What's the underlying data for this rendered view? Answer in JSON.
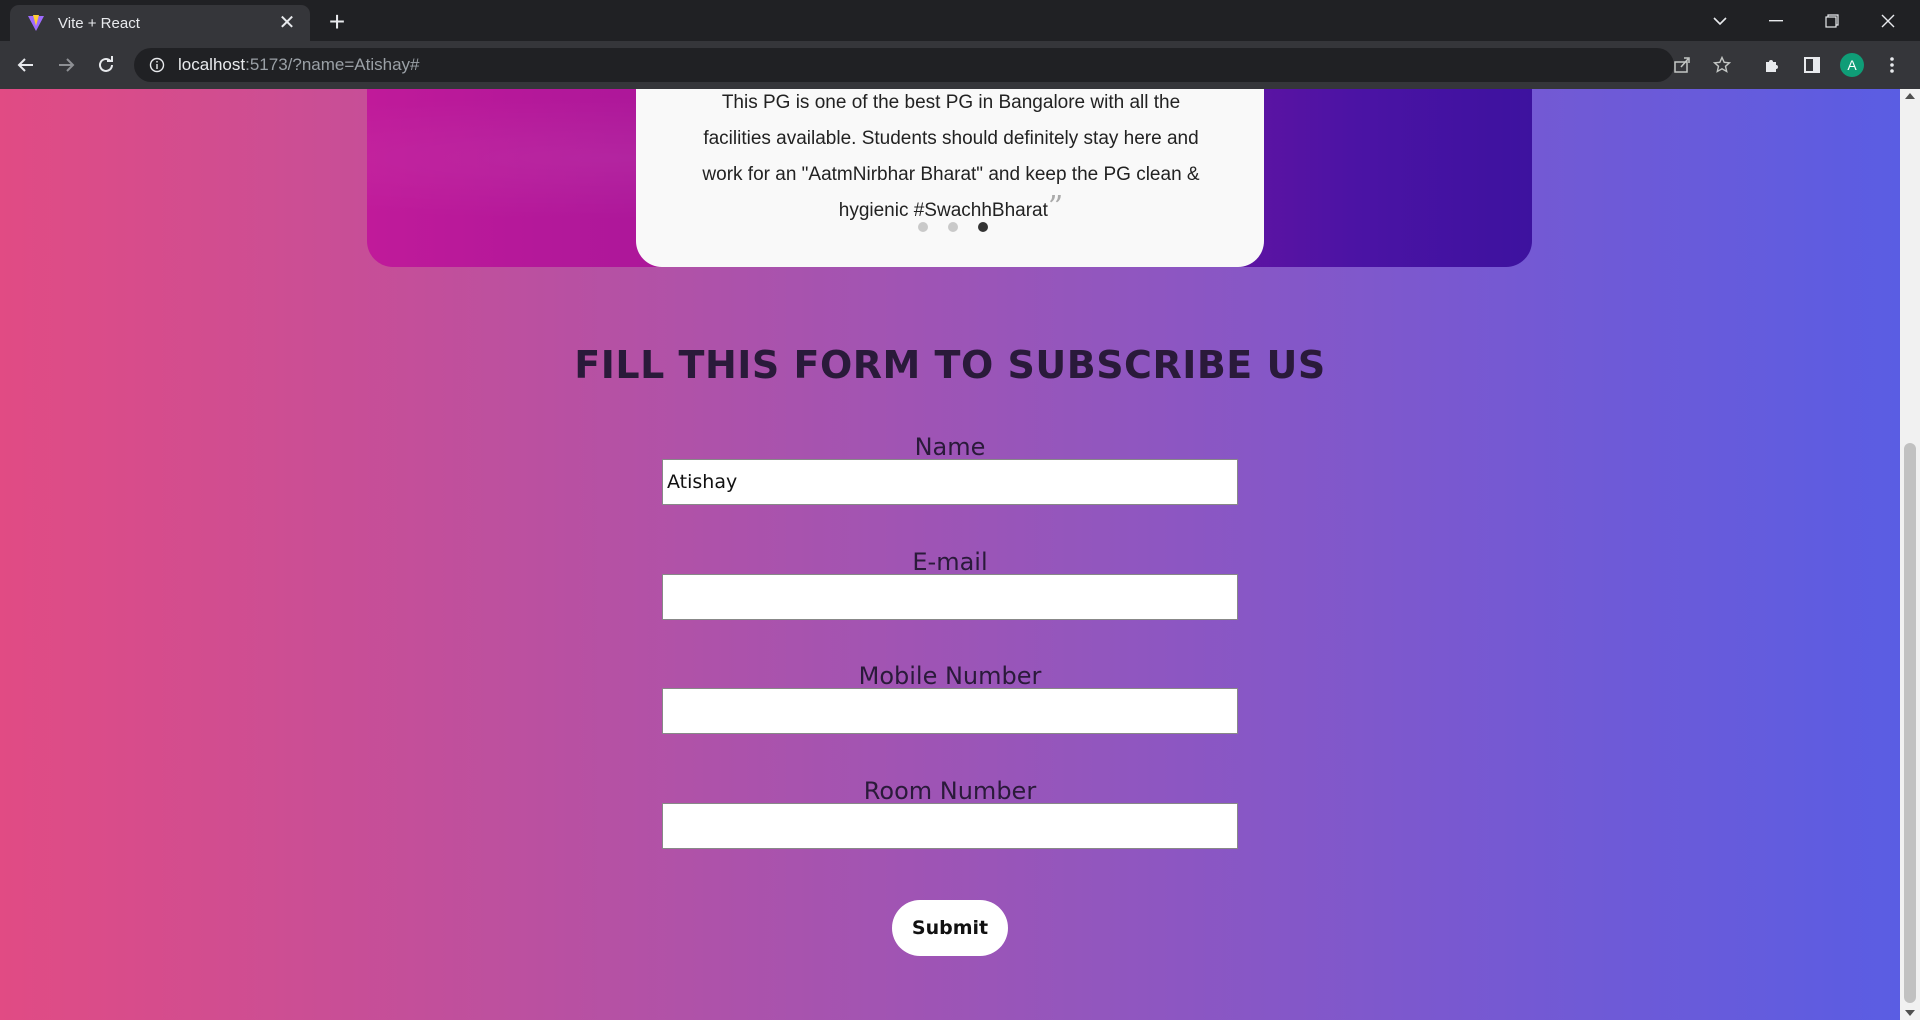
{
  "browser": {
    "tab_title": "Vite + React",
    "url_host": "localhost",
    "url_rest": ":5173/?name=Atishay#",
    "avatar_letter": "A"
  },
  "testimonial": {
    "text": "This PG is one of the best PG in Bangalore with all the facilities available. Students should definitely stay here and work for an \"AatmNirbhar Bharat\" and keep the PG clean & hygienic #SwachhBharat",
    "quote_glyph": "”",
    "dots_count": 3,
    "active_dot": 2
  },
  "form": {
    "title": "FILL THIS FORM TO SUBSCRIBE US",
    "name_label": "Name",
    "name_value": "Atishay",
    "email_label": "E-mail",
    "email_value": "",
    "mobile_label": "Mobile Number",
    "mobile_value": "",
    "room_label": "Room Number",
    "room_value": "",
    "submit_label": "Submit"
  },
  "colors": {
    "gradient_start": "#e14b84",
    "gradient_end": "#5a5de3",
    "chrome_bg": "#202124",
    "toolbar_bg": "#35363a"
  }
}
